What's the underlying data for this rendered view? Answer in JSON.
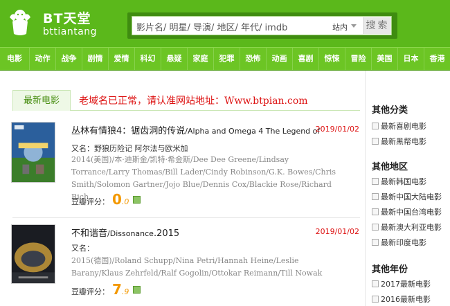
{
  "header": {
    "logo_title": "BT天堂",
    "logo_sub": "bttiantang",
    "search_placeholder": "影片名/ 明星/ 导演/ 地区/ 年代/ imdb",
    "scope": "站内",
    "search_button": "搜索"
  },
  "nav": [
    "电影",
    "动作",
    "战争",
    "剧情",
    "爱情",
    "科幻",
    "悬疑",
    "家庭",
    "犯罪",
    "恐怖",
    "动画",
    "喜剧",
    "惊悚",
    "冒险",
    "美国",
    "日本",
    "香港"
  ],
  "main": {
    "tab": "最新电影",
    "notice": "老域名已正常，请认准网站地址：Www.btpian.com",
    "films": [
      {
        "title": "丛林有情狼4：锯齿洞的传说",
        "title_en": "/Alpha and Omega 4 The Legend of",
        "date": "2019/01/02",
        "alias": "又名：野狼历险记 阿尔法与欧米加",
        "cast": "2014(美国)/本·迪斯金/凯特·希金斯/Dee Dee Greene/Lindsay Torrance/Larry Thomas/Bill Lader/Cindy Robinson/G.K. Bowes/Chris Smith/Solomon Gartner/Jojo Blue/Dennis Cox/Blackie Rose/Richard Rich",
        "rating_label": "豆瓣评分：",
        "score_int": "0",
        "score_dec": ".0"
      },
      {
        "title": "不和谐音",
        "title_en": "/Dissonance",
        "title_year": ".2015",
        "date": "2019/01/02",
        "alias": "又名：",
        "cast": "2015(德国)/Roland Schupp/Nina Petri/Hannah Heine/Leslie Barany/Klaus Zehrfeld/Ralf Gogolin/Ottokar Reimann/Till Nowak",
        "rating_label": "豆瓣评分：",
        "score_int": "7",
        "score_dec": ".9"
      }
    ]
  },
  "sidebar": {
    "cat_heading": "其他分类",
    "cat_items": [
      "最新喜剧电影",
      "最新黑帮电影"
    ],
    "region_heading": "其他地区",
    "region_items": [
      "最新韩国电影",
      "最新中国大陆电影",
      "最新中国台湾电影",
      "最新澳大利亚电影",
      "最新印度电影"
    ],
    "year_heading": "其他年份",
    "year_items": [
      "2017最新电影",
      "2016最新电影"
    ]
  },
  "colors": {
    "header_green": "#5bb81b",
    "nav_green": "#6cc524",
    "date_red": "#dd1111",
    "score_orange": "#f39800"
  }
}
